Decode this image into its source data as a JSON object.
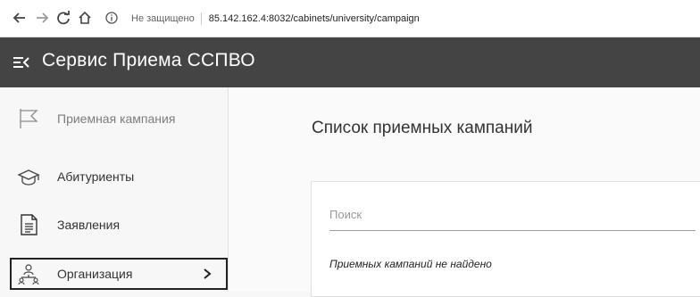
{
  "browser": {
    "security_label": "Не защищено",
    "url": "85.142.162.4:8032/cabinets/university/campaign"
  },
  "header": {
    "title": "Сервис Приема ССПВО"
  },
  "sidebar": {
    "items": [
      {
        "label": "Приемная кампания",
        "icon": "flag-icon"
      },
      {
        "label": "Абитуриенты",
        "icon": "graduation-cap-icon"
      },
      {
        "label": "Заявления",
        "icon": "document-icon"
      },
      {
        "label": "Организация",
        "icon": "organization-icon"
      }
    ]
  },
  "main": {
    "title": "Список приемных кампаний",
    "search_placeholder": "Поиск",
    "empty_message": "Приемных кампаний не найдено"
  }
}
